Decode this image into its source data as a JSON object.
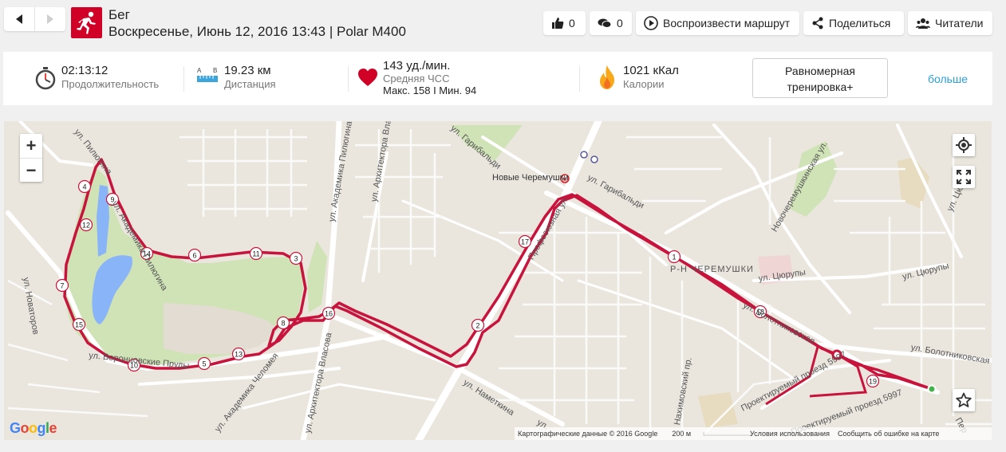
{
  "header": {
    "sport": "Бег",
    "subtitle": "Воскресенье, Июнь 12, 2016 13:43 | Polar M400",
    "likes": "0",
    "comments": "0",
    "replay_label": "Воспроизвести маршрут",
    "share_label": "Поделиться",
    "followers_label": "Читатели"
  },
  "summary": {
    "duration_value": "02:13:12",
    "duration_label": "Продолжительность",
    "distance_value": "19.23 км",
    "distance_label": "Дистанция",
    "distance_icon_a": "A",
    "distance_icon_b": "B",
    "hr_value": "143 уд./мин.",
    "hr_label": "Средняя ЧСС",
    "hr_minmax": "Макс. 158  I  Мин. 94",
    "calories_value": "1021 кКал",
    "calories_label": "Калории",
    "training_line1": "Равномерная",
    "training_line2": "тренировка+",
    "more_label": "больше"
  },
  "map": {
    "metro_station": "Новые Черемушки",
    "district": "Р-Н ЧЕРЕМУШКИ",
    "streets": {
      "piliugina_top": "ул. Пилюгина",
      "akad_piliugina": "ул. Академика Пилюгина",
      "akad_piliugina2": "ул. Академика Пилюгина",
      "arkh_vlasova": "ул. Архитектора Власова",
      "arkh_vlasova2": "ул. Архитектора Власова",
      "profsoyuznaya": "Профсоюзная ул.",
      "garibaldi_top": "ул. Гарибальди",
      "garibaldi": "ул. Гарибальди",
      "novatorov": "ул. Новаторов",
      "vorontsovskie": "ул. Воронцовские Пруды",
      "chelomeya": "ул. Академика Челомея",
      "nametkina": "ул. Наметкина",
      "tsyurupy1": "ул. Цюрупы",
      "tsyurupy2": "ул. Цюрупы",
      "tsyurupy3": "ул. Цюрупы",
      "bolotnikovskaya": "ул. Болотниковская",
      "bolotnikovskaya2": "ул. Болотниковская",
      "novocheremushkinskaya": "Новочеремушкинская ул.",
      "proektiruemy1": "Проектируемый проезд 5997",
      "proektiruemy2": "Проектируемый проезд 5997",
      "nakhimovsky": "Нахимовский пр.",
      "nametkina_lower": "ул.",
      "perek": "Пер"
    },
    "km_markers": [
      "1",
      "2",
      "3",
      "4",
      "5",
      "6",
      "7",
      "8",
      "9",
      "10",
      "11",
      "12",
      "13",
      "14",
      "15",
      "16",
      "17",
      "18",
      "19"
    ],
    "google": "Google",
    "copyright": "Картографические данные © 2016 Google",
    "scale_label": "200 м",
    "terms": "Условия использования",
    "report": "Сообщить об ошибке на карте",
    "zoom_in": "+",
    "zoom_out": "−",
    "colors": {
      "route": "#c8143c",
      "park": "#cfe3b6",
      "water": "#8ab4f8",
      "road": "#ffffff"
    }
  }
}
